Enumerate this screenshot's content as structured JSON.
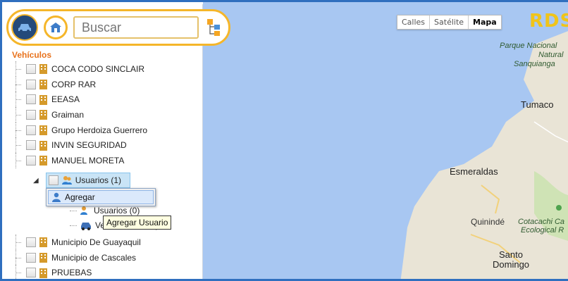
{
  "toolbar": {
    "search_placeholder": "Buscar"
  },
  "map": {
    "buttons": [
      "Calles",
      "Satélite",
      "Mapa"
    ],
    "active_button": "Mapa",
    "logo": "RDS",
    "labels": {
      "parque": "Parque Nacional",
      "natural": "Natural",
      "sanquianga": "Sanquianga",
      "tumaco": "Tumaco",
      "esmeraldas": "Esmeraldas",
      "quininde": "Quinindé",
      "cotacachi": "Cotacachi Ca",
      "ecological": "Ecological R",
      "santo": "Santo",
      "domingo": "Domingo"
    }
  },
  "panel": {
    "section_title": "Vehículos",
    "groups": [
      "COCA CODO SINCLAIR",
      "CORP RAR",
      "EEASA",
      "Graiman",
      "Grupo Herdoiza Guerrero",
      "INVIN SEGURIDAD",
      "MANUEL MORETA"
    ],
    "selected_node": "Usuarios (1)",
    "child_users": "Usuarios (0)",
    "child_vehicles": "Ve",
    "child_vehicles_tail": ")",
    "groups_after": [
      "Municipio De Guayaquil",
      "Municipio de Cascales",
      "PRUEBAS"
    ]
  },
  "context_menu": {
    "agregar": "Agregar"
  },
  "tooltip": "Agregar Usuario",
  "colors": {
    "accent_orange": "#f5b62a",
    "title_orange": "#e8721c",
    "map_water": "#a8c7f2",
    "frame_blue": "#2f6fbf"
  }
}
